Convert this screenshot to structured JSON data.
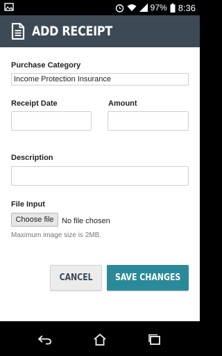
{
  "status_bar": {
    "battery_percent": "97%",
    "time": "8:36",
    "icons": [
      "image-notification-icon",
      "alarm-icon",
      "wifi-icon",
      "signal-icon",
      "battery-icon"
    ]
  },
  "app_bar": {
    "title": "ADD RECEIPT",
    "icon": "document-icon",
    "color": "#3d4a56"
  },
  "form": {
    "purchase_category": {
      "label": "Purchase Category",
      "selected_value": "Income Protection Insurance"
    },
    "receipt_date": {
      "label": "Receipt Date",
      "value": ""
    },
    "amount": {
      "label": "Amount",
      "value": ""
    },
    "description": {
      "label": "Description",
      "value": ""
    },
    "file_input": {
      "label": "File Input",
      "button_label": "Choose file",
      "status_text": "No file chosen",
      "hint": "Maximum image size is 2MB."
    }
  },
  "actions": {
    "cancel_label": "CANCEL",
    "save_label": "SAVE CHANGES",
    "save_color": "#2a8a99"
  },
  "nav_bar": {
    "icons": [
      "back-icon",
      "home-icon",
      "recent-apps-icon"
    ]
  }
}
